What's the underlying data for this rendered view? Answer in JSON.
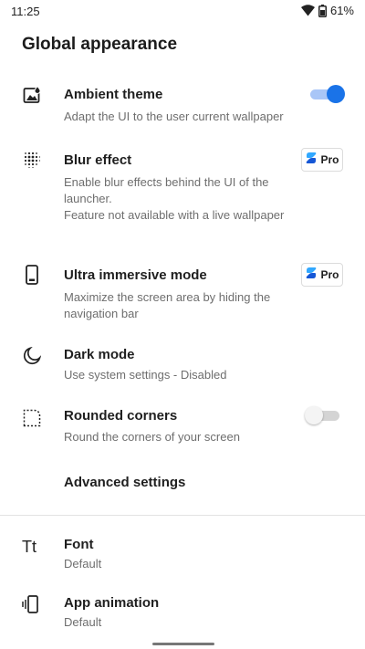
{
  "status_bar": {
    "time": "11:25",
    "battery": "61%"
  },
  "page": {
    "title": "Global appearance"
  },
  "settings": [
    {
      "icon": "wallpaper-icon",
      "title": "Ambient theme",
      "subtitle": "Adapt the UI to the user current wallpaper",
      "control": "toggle",
      "checked": true
    },
    {
      "icon": "blur-dots-icon",
      "title": "Blur effect",
      "subtitle": "Enable blur effects behind the UI of the launcher.\nFeature not available with a live wallpaper",
      "control": "pro-badge"
    },
    {
      "icon": "phone-icon",
      "title": "Ultra immersive mode",
      "subtitle": "Maximize the screen area by hiding the navigation bar",
      "control": "pro-badge"
    },
    {
      "icon": "moon-icon",
      "title": "Dark mode",
      "subtitle": "Use system settings - Disabled"
    },
    {
      "icon": "rounded-corners-icon",
      "title": "Rounded corners",
      "subtitle": "Round the corners of your screen",
      "control": "toggle",
      "checked": false
    },
    {
      "title": "Advanced settings"
    },
    {
      "icon": "font-icon",
      "icon_glyph": "Tt",
      "title": "Font",
      "subtitle": "Default"
    },
    {
      "icon": "vibrate-phone-icon",
      "title": "App animation",
      "subtitle": "Default"
    }
  ],
  "pro_badge": {
    "label": "Pro"
  },
  "colors": {
    "accent": "#1a73e8",
    "accent_track": "#a9c6f7",
    "text_primary": "#1f1f1f",
    "text_secondary": "#6e6e6e"
  }
}
